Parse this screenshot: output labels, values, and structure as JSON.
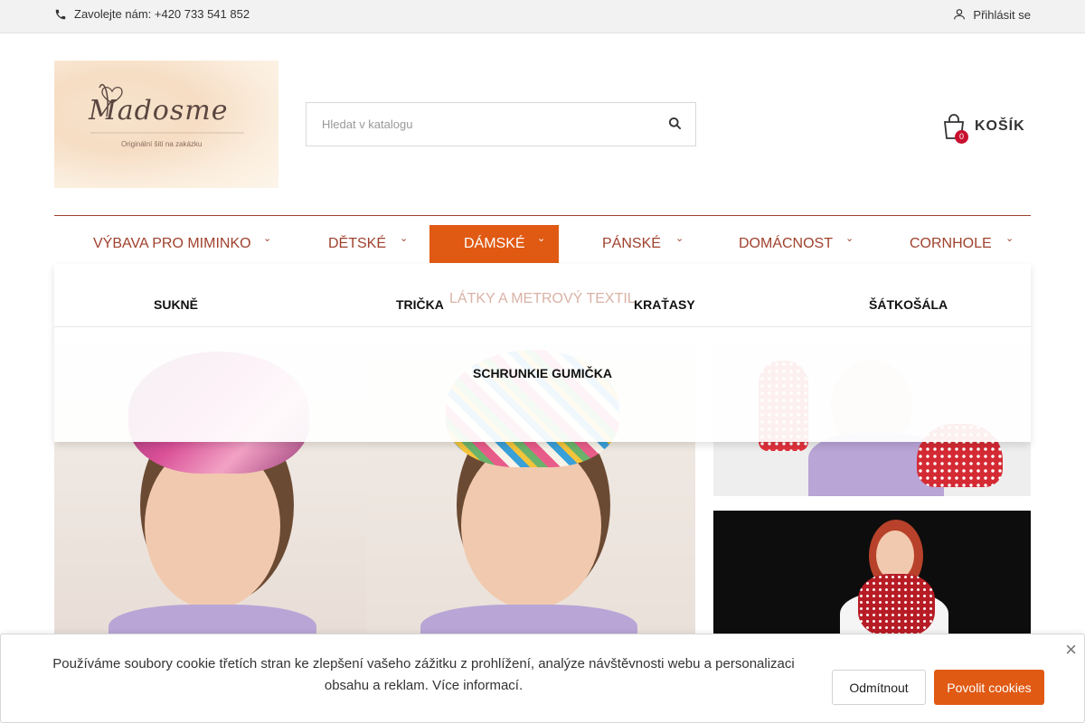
{
  "topbar": {
    "phone_text": "Zavolejte nám: +420 733 541 852",
    "login_label": "Přihlásit se"
  },
  "header": {
    "logo_text": "Madosme",
    "logo_tagline": "Originální šití na zakázku",
    "search_placeholder": "Hledat v katalogu",
    "cart_label": "KOŠÍK",
    "cart_count": "0"
  },
  "nav": {
    "items": [
      {
        "label": "VÝBAVA PRO MIMINKO",
        "caret": "⌄"
      },
      {
        "label": "DĚTSKÉ",
        "caret": "⌄"
      },
      {
        "label": "DÁMSKÉ",
        "caret": "⌄",
        "active": true
      },
      {
        "label": "PÁNSKÉ",
        "caret": "⌄"
      },
      {
        "label": "DOMÁCNOST",
        "caret": "⌄"
      },
      {
        "label": "CORNHOLE",
        "caret": "⌄"
      }
    ],
    "hidden_behind_dropdown": "LÁTKY A METROVÝ TEXTIL"
  },
  "dropdown": {
    "subcategories": [
      "SUKNĚ",
      "TRIČKA",
      "KRAŤASY",
      "ŠÁTKOŠÁLA",
      "SCHRUNKIE GUMIČKA"
    ]
  },
  "cookie_bar": {
    "message": "Používáme soubory cookie třetích stran ke zlepšení vašeho zážitku z prohlížení, analýze návštěvnosti webu a personalizaci obsahu a reklam. Více informací.",
    "deny_label": "Odmítnout",
    "allow_label": "Povolit cookies",
    "close_symbol": "×"
  },
  "colors": {
    "accent": "#e05a14",
    "nav_text": "#a0412d",
    "badge": "#c8102e"
  },
  "icons": [
    "phone-icon",
    "user-icon",
    "search-icon",
    "cart-bag-icon",
    "close-icon"
  ]
}
